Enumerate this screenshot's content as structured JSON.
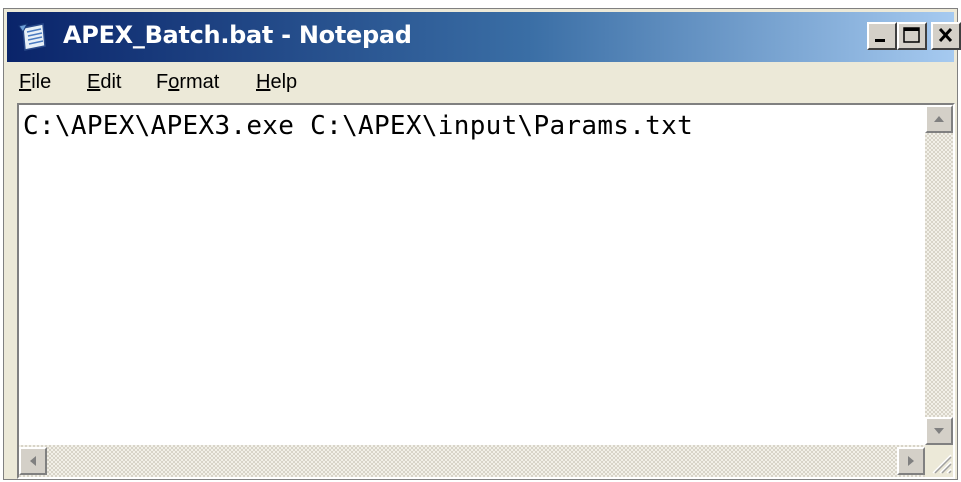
{
  "window": {
    "title": "APEX_Batch.bat - Notepad",
    "title_bar_color": "#0a246a",
    "app_icon": "notepad-icon"
  },
  "caption_buttons": {
    "minimize_icon": "minimize-icon",
    "maximize_icon": "maximize-icon",
    "close_icon": "close-icon"
  },
  "menu": {
    "items": [
      {
        "mnemonic": "F",
        "rest": "ile"
      },
      {
        "mnemonic": "E",
        "rest": "dit"
      },
      {
        "pre": "F",
        "mnemonic": "o",
        "rest": "rmat"
      },
      {
        "mnemonic": "H",
        "rest": "elp"
      }
    ]
  },
  "editor": {
    "content": "C:\\APEX\\APEX3.exe C:\\APEX\\input\\Params.txt"
  },
  "scrollbars": {
    "up_icon": "arrow-up-icon",
    "down_icon": "arrow-down-icon",
    "left_icon": "arrow-left-icon",
    "right_icon": "arrow-right-icon"
  }
}
